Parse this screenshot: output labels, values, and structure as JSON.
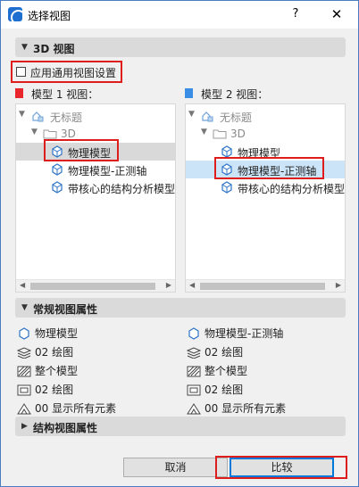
{
  "window": {
    "title": "选择视图",
    "help": "?",
    "close": "✕"
  },
  "section_3d": {
    "label": "3D 视图"
  },
  "use_common": {
    "label": "应用通用视图设置",
    "checked": false
  },
  "model1": {
    "label": "模型 1 视图：",
    "color": "#e8262b",
    "tree": {
      "root": "无标题",
      "folder": "3D",
      "items": [
        "物理模型",
        "物理模型-正测轴",
        "带核心的结构分析模型"
      ],
      "selected_index": 0
    }
  },
  "model2": {
    "label": "模型 2 视图：",
    "color": "#3a8ee6",
    "tree": {
      "root": "无标题",
      "folder": "3D",
      "items": [
        "物理模型",
        "物理模型-正测轴",
        "带核心的结构分析模型"
      ],
      "selected_index": 1
    }
  },
  "section_general": {
    "label": "常规视图属性"
  },
  "props_left": [
    "物理模型",
    "02 绘图",
    "整个模型",
    "02 绘图",
    "00 显示所有元素"
  ],
  "props_right": [
    "物理模型-正测轴",
    "02 绘图",
    "整个模型",
    "02 绘图",
    "00 显示所有元素"
  ],
  "section_structure": {
    "label": "结构视图属性"
  },
  "buttons": {
    "cancel": "取消",
    "compare": "比较"
  }
}
